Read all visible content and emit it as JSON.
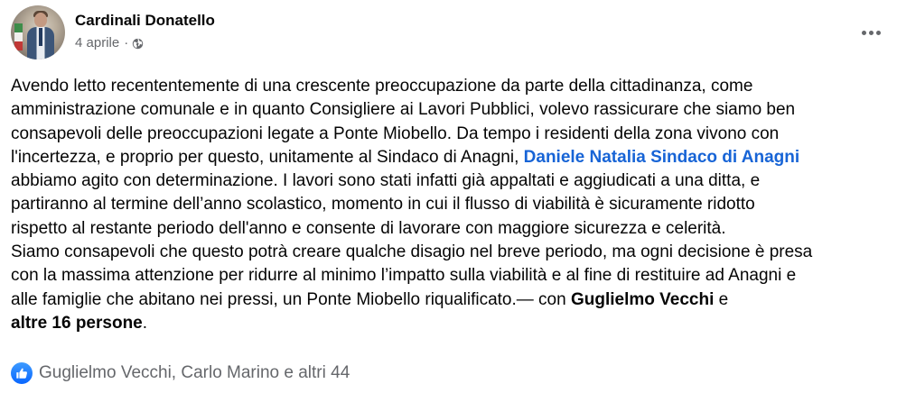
{
  "post": {
    "author": "Cardinali Donatello",
    "date": "4 aprile",
    "separator": "·",
    "visibility_icon": "globe-icon",
    "more_icon": "more-horizontal-icon",
    "body": {
      "line1": "Avendo letto recententemente di una crescente preoccupazione da parte della cittadinanza, come",
      "line2": "amministrazione comunale e in quanto Consigliere ai Lavori Pubblici, volevo rassicurare che siamo ben",
      "line3": "consapevoli delle preoccupazioni legate a Ponte Miobello. Da tempo i residenti della zona vivono con",
      "line4_pre": "l'incertezza, e proprio per questo, unitamente al Sindaco di Anagni, ",
      "mention": "Daniele Natalia Sindaco di Anagni",
      "line5": "abbiamo agito con determinazione. I lavori sono stati infatti già appaltati e aggiudicati a una ditta, e",
      "line6": "partiranno al termine dell’anno scolastico, momento in cui il flusso di viabilità è sicuramente ridotto",
      "line7": "rispetto al restante periodo dell'anno e consente di lavorare con maggiore sicurezza e celerità.",
      "line8": "Siamo consapevoli che questo potrà creare qualche disagio nel breve periodo, ma ogni decisione è presa",
      "line9": "con la massima attenzione per ridurre al minimo l’impatto sulla viabilità e al fine di restituire ad Anagni e",
      "line10_pre": "alle famiglie che abitano nei pressi, un Ponte Miobello riqualificato.— con ",
      "tagged_person": "Guglielmo Vecchi",
      "line10_post": " e",
      "tagged_others": "altre 16 persone",
      "end_punct": "."
    },
    "reactions": {
      "icon": "like-icon",
      "text": "Guglielmo Vecchi, Carlo Marino e altri 44"
    },
    "colors": {
      "mention": "#1764d6",
      "secondary_text": "#65676b",
      "like_blue": "#0866ff"
    }
  }
}
